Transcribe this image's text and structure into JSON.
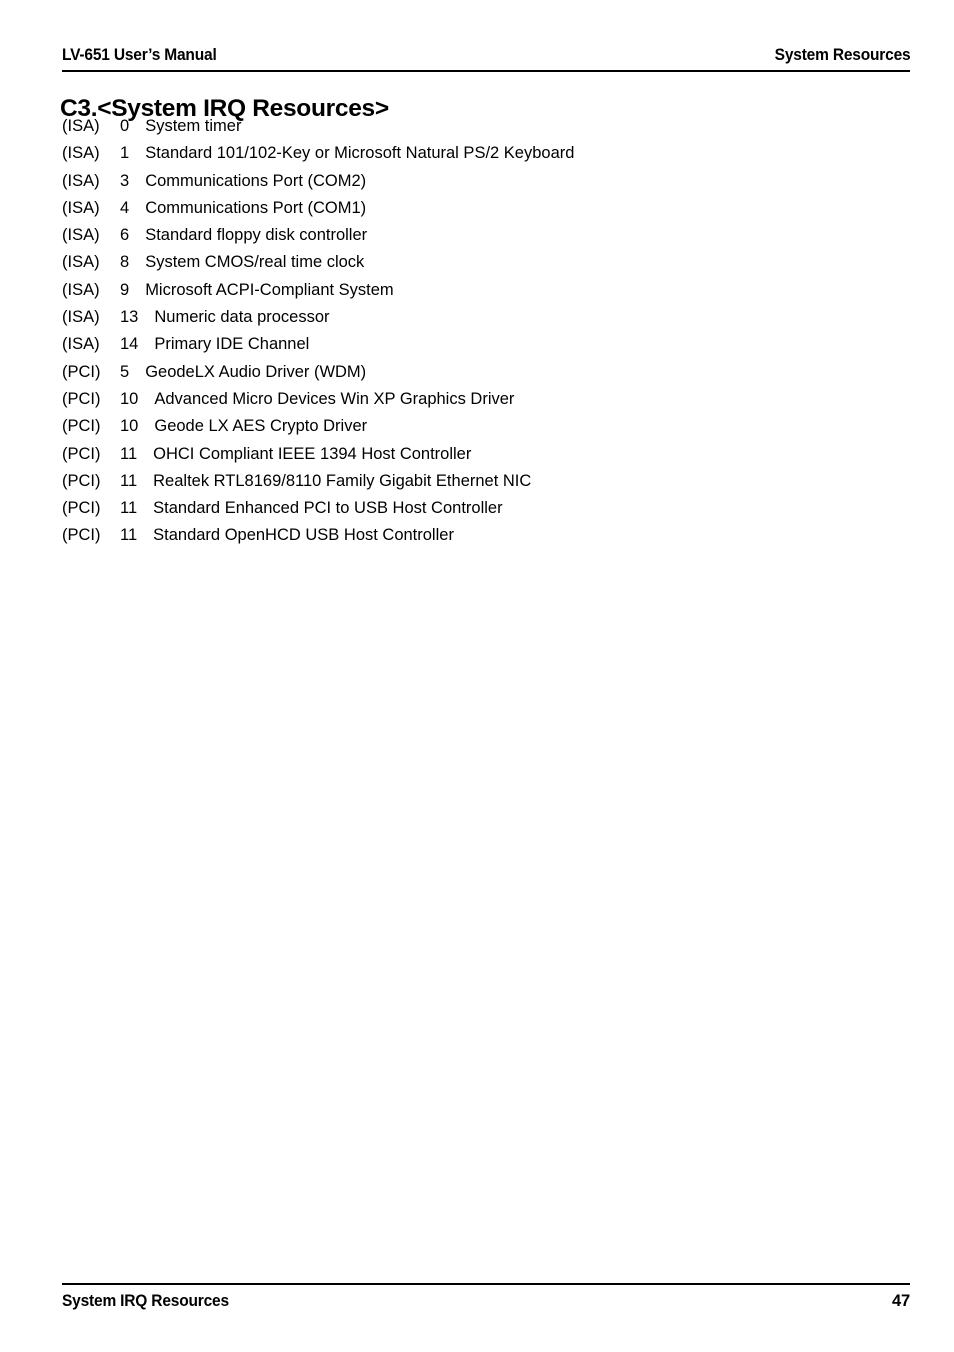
{
  "header": {
    "left": "LV-651 User’s Manual",
    "right": "System Resources"
  },
  "title": "C3.<System IRQ Resources>",
  "irq_entries": [
    {
      "bus": "(ISA)",
      "irq": "0",
      "description": "System timer"
    },
    {
      "bus": "(ISA)",
      "irq": "1",
      "description": "Standard 101/102-Key or Microsoft Natural PS/2 Keyboard"
    },
    {
      "bus": "(ISA)",
      "irq": "3",
      "description": "Communications Port (COM2)"
    },
    {
      "bus": "(ISA)",
      "irq": "4",
      "description": "Communications Port (COM1)"
    },
    {
      "bus": "(ISA)",
      "irq": "6",
      "description": "Standard floppy disk controller"
    },
    {
      "bus": "(ISA)",
      "irq": "8",
      "description": "System CMOS/real time clock"
    },
    {
      "bus": "(ISA)",
      "irq": "9",
      "description": "Microsoft ACPI-Compliant System"
    },
    {
      "bus": "(ISA)",
      "irq": "13",
      "description": "Numeric data processor"
    },
    {
      "bus": "(ISA)",
      "irq": "14",
      "description": "Primary IDE Channel"
    },
    {
      "bus": "(PCI)",
      "irq": "5",
      "description": "GeodeLX Audio Driver (WDM)"
    },
    {
      "bus": "(PCI)",
      "irq": "10",
      "description": "Advanced Micro Devices Win XP Graphics Driver"
    },
    {
      "bus": "(PCI)",
      "irq": "10",
      "description": "Geode LX AES Crypto Driver"
    },
    {
      "bus": "(PCI)",
      "irq": "11",
      "description": "OHCI Compliant IEEE 1394 Host Controller"
    },
    {
      "bus": "(PCI)",
      "irq": "11",
      "description": "Realtek RTL8169/8110 Family Gigabit Ethernet NIC"
    },
    {
      "bus": "(PCI)",
      "irq": "11",
      "description": "Standard Enhanced PCI to USB Host Controller"
    },
    {
      "bus": "(PCI)",
      "irq": "11",
      "description": "Standard OpenHCD USB Host Controller"
    }
  ],
  "footer": {
    "left": "System IRQ Resources",
    "page_number": "47"
  }
}
